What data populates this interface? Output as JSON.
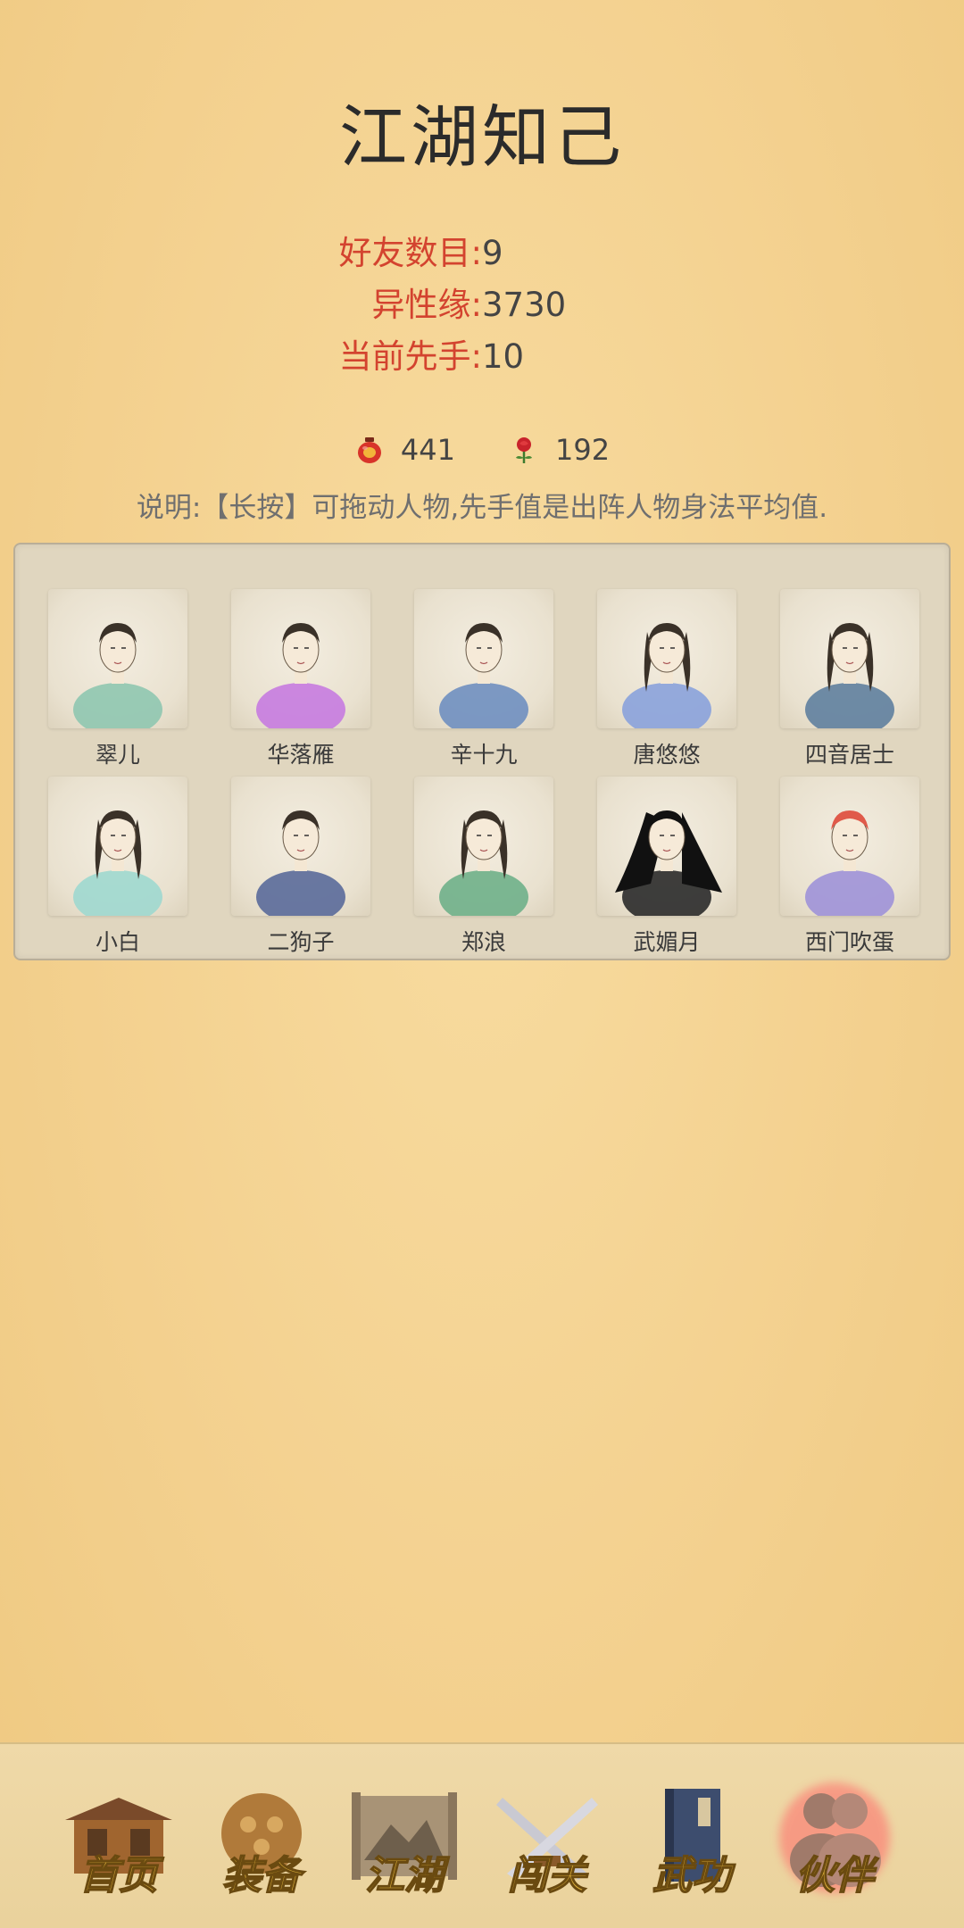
{
  "page": {
    "title": "江湖知己"
  },
  "stats": [
    {
      "label": "好友数目:",
      "value": "9"
    },
    {
      "label": "异性缘:",
      "value": "3730"
    },
    {
      "label": "当前先手:",
      "value": "10"
    }
  ],
  "currency": {
    "wine": {
      "value": "441",
      "icon": "wine-jar-icon"
    },
    "rose": {
      "value": "192",
      "icon": "rose-icon"
    }
  },
  "note": "说明:【长按】可拖动人物,先手值是出阵人物身法平均值.",
  "characters": [
    {
      "name": "翠儿",
      "color": "#8fc7b0"
    },
    {
      "name": "华落雁",
      "color": "#c77be0"
    },
    {
      "name": "辛十九",
      "color": "#6f8fc0"
    },
    {
      "name": "唐悠悠",
      "color": "#8aa2dc"
    },
    {
      "name": "四音居士",
      "color": "#5f7f9f"
    },
    {
      "name": "小白",
      "color": "#9fd8cf"
    },
    {
      "name": "二狗子",
      "color": "#5a6a9a"
    },
    {
      "name": "郑浪",
      "color": "#6fb08a"
    },
    {
      "name": "武媚月",
      "color": "#2a2a2a"
    },
    {
      "name": "西门吹蛋",
      "color": "#9f92d8"
    }
  ],
  "nav": [
    {
      "label": "首页",
      "icon": "house-icon",
      "active": false
    },
    {
      "label": "装备",
      "icon": "armor-icon",
      "active": false
    },
    {
      "label": "江湖",
      "icon": "scroll-map-icon",
      "active": false
    },
    {
      "label": "闯关",
      "icon": "crossed-swords-icon",
      "active": false
    },
    {
      "label": "武功",
      "icon": "book-icon",
      "active": false
    },
    {
      "label": "伙伴",
      "icon": "companions-icon",
      "active": true
    }
  ]
}
